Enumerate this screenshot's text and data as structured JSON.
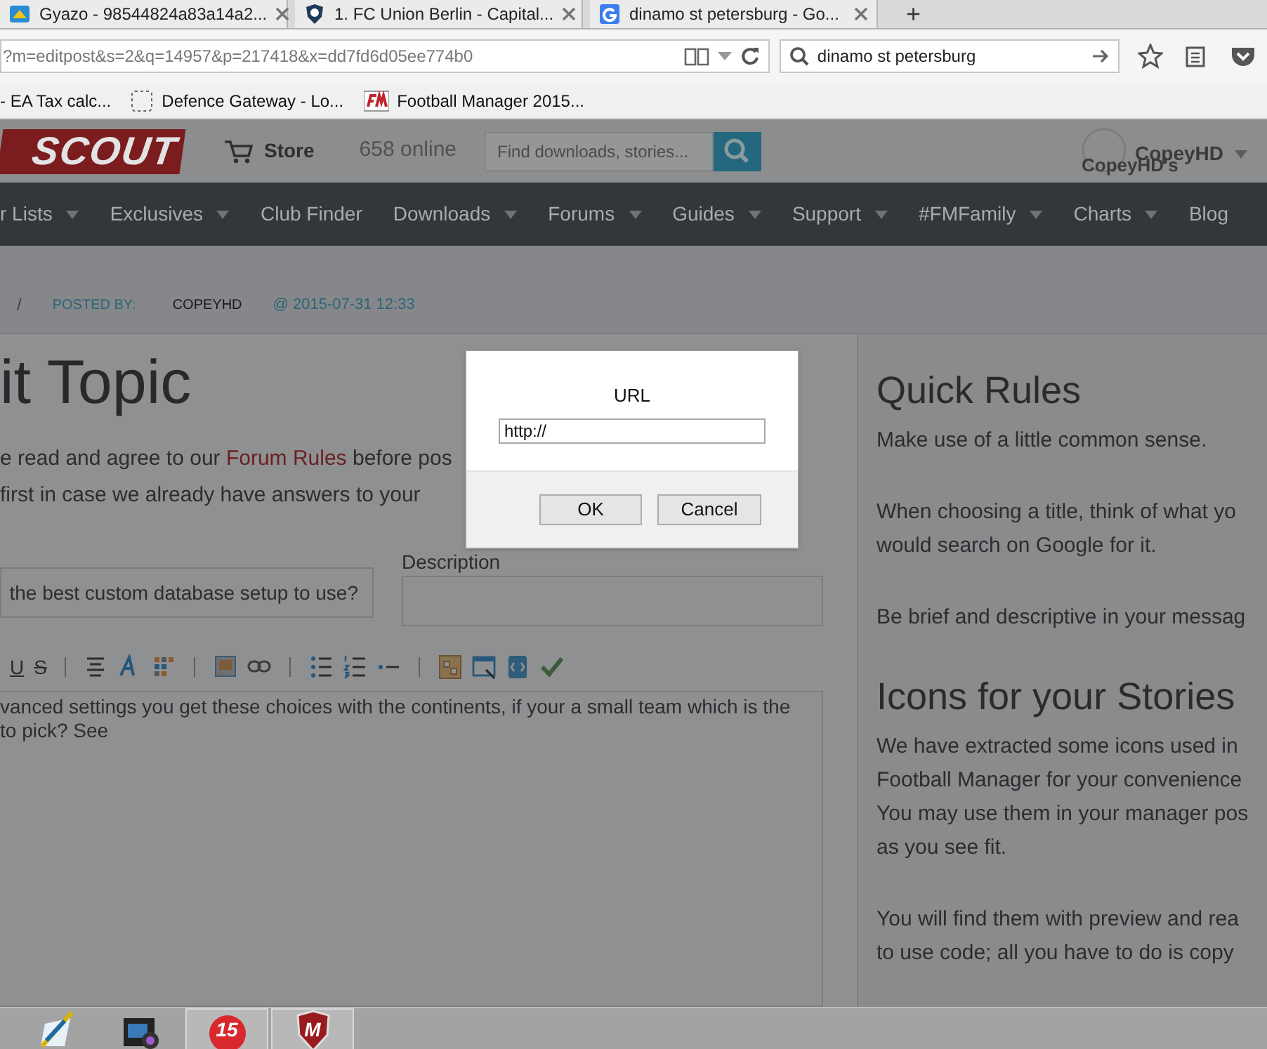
{
  "browser": {
    "tabs": [
      {
        "title": "Gyazo - 98544824a83a14a2...",
        "selected": false
      },
      {
        "title": "1. FC Union Berlin - Capital...",
        "selected": false
      },
      {
        "title": "dinamo st petersburg - Go...",
        "selected": false
      }
    ],
    "new_tab": "+",
    "address": "?m=editpost&s=2&q=14957&p=217418&x=dd7fd6d05ee774b0",
    "search": "dinamo st petersburg",
    "bookmarks": [
      "- EA Tax calc...",
      "Defence Gateway - Lo...",
      "Football Manager 2015..."
    ]
  },
  "site": {
    "logo": "SCOUT",
    "store": "Store",
    "online": "658 online",
    "search_placeholder": "Find downloads, stories...",
    "user": "CopeyHD",
    "user_caption": "CopeyHD's",
    "nav": [
      {
        "label": "r Lists",
        "caret": true
      },
      {
        "label": "Exclusives",
        "caret": true
      },
      {
        "label": "Club Finder",
        "caret": false
      },
      {
        "label": "Downloads",
        "caret": true
      },
      {
        "label": "Forums",
        "caret": true
      },
      {
        "label": "Guides",
        "caret": true
      },
      {
        "label": "Support",
        "caret": true
      },
      {
        "label": "#FMFamily",
        "caret": true
      },
      {
        "label": "Charts",
        "caret": true
      },
      {
        "label": "Blog",
        "caret": false
      }
    ],
    "meta": {
      "separator": "/",
      "posted_by": "POSTED BY:",
      "author": "COPEYHD",
      "date": "@ 2015-07-31 12:33"
    }
  },
  "main": {
    "title": "it Topic",
    "intro": {
      "before": "e read and agree to our ",
      "link": "Forum Rules",
      "after": " before pos",
      "line_2": "first in case we already have answers to your"
    },
    "title_value": "the best custom database setup to use?",
    "description_label": "Description",
    "toolbar": {
      "underline": "U",
      "strike": "S"
    },
    "editor_lines": [
      "vanced settings you get these choices with the continents, if your a small team which is the",
      "to pick? See"
    ]
  },
  "sidebar": [
    {
      "heading": "Quick Rules",
      "paragraphs": [
        [
          "Make use of a little common sense."
        ],
        [
          "When choosing a title, think of what yo",
          "would search on Google for it."
        ],
        [
          "Be brief and descriptive in your messag"
        ]
      ]
    },
    {
      "heading": "Icons for your Stories",
      "paragraphs": [
        [
          "We have extracted some icons used in",
          "Football Manager for your convenience",
          "You may use them in your manager pos",
          "as you see fit."
        ],
        [
          "You will find them with preview and rea",
          "to use code; all you have to do is copy"
        ]
      ]
    }
  ],
  "dialog": {
    "label": "URL",
    "value": "http://",
    "buttons": [
      "OK",
      "Cancel"
    ]
  },
  "taskbar": [
    {
      "active": false
    },
    {
      "active": false
    },
    {
      "label": "15",
      "active": true
    },
    {
      "label": "M",
      "active": true
    }
  ]
}
